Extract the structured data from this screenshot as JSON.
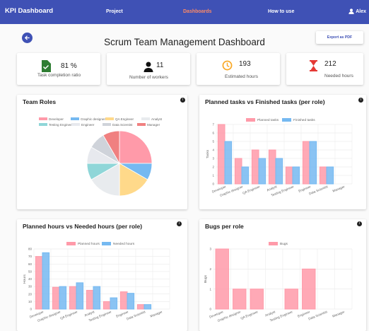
{
  "nav": {
    "brand": "KPI Dashboard",
    "items": [
      "Project",
      "Dashboards",
      "How to use"
    ],
    "user": "Alex"
  },
  "page": {
    "title": "Scrum Team Management Dashboard",
    "export_label": "Export as PDF"
  },
  "kpis": [
    {
      "value": "81 %",
      "label": "Task completion ratio",
      "icon": "check-document-icon",
      "color": "#2e7d32"
    },
    {
      "value": "11",
      "label": "Number of workers",
      "icon": "person-icon",
      "color": "#111111"
    },
    {
      "value": "193",
      "label": "Estimated hours",
      "icon": "clock-icon",
      "color": "#f9a825"
    },
    {
      "value": "212",
      "label": "Needed hours",
      "icon": "hourglass-icon",
      "color": "#e53935"
    }
  ],
  "colors": {
    "roles": [
      "#ff9aa9",
      "#75b9f1",
      "#ffd98a",
      "#e8ebee",
      "#8fd6d8",
      "#e7e9ee",
      "#cfd3da",
      "#f08080"
    ],
    "pink": "#ff9aa9",
    "blue": "#75b9f1",
    "accent": "#3f51b5"
  },
  "chart_data": [
    {
      "type": "pie",
      "title": "Team Roles",
      "legend": [
        "Developer",
        "Graphic designer",
        "QA Engineer",
        "Analyst",
        "Testing Engineer",
        "Engineer",
        "Data Scientist",
        "Manager"
      ],
      "values": [
        3,
        1,
        2,
        2,
        1,
        1,
        1,
        1
      ],
      "legend_position": "top"
    },
    {
      "type": "bar",
      "title": "Planned tasks vs Finished tasks (per role)",
      "categories": [
        "Developer",
        "Graphic designer",
        "QA Engineer",
        "Analyst",
        "Testing Engineer",
        "Engineer",
        "Data Scientist",
        "Manager"
      ],
      "series": [
        {
          "name": "Planned tasks",
          "values": [
            7,
            3,
            4,
            4,
            2,
            5,
            2,
            0
          ]
        },
        {
          "name": "Finished tasks",
          "values": [
            5,
            2,
            3,
            3,
            2,
            5,
            2,
            0
          ]
        }
      ],
      "ylabel": "Tasks",
      "ylim": [
        0,
        7
      ],
      "yticks": [
        0,
        1,
        2,
        3,
        4,
        5,
        6,
        7
      ]
    },
    {
      "type": "bar",
      "title": "Planned hours vs Needed hours (per role)",
      "categories": [
        "Developer",
        "Graphic designer",
        "QA Engineer",
        "Analyst",
        "Testing Engineer",
        "Engineer",
        "Data Scientist",
        "Manager"
      ],
      "series": [
        {
          "name": "Planned hours",
          "values": [
            70,
            29,
            30,
            25,
            10,
            23,
            6,
            0
          ]
        },
        {
          "name": "Needed hours",
          "values": [
            75,
            30,
            35,
            30,
            15,
            21,
            6,
            0
          ]
        }
      ],
      "ylabel": "Hours",
      "ylim": [
        0,
        80
      ],
      "yticks": [
        0,
        10,
        20,
        30,
        40,
        50,
        60,
        70,
        80
      ]
    },
    {
      "type": "bar",
      "title": "Bugs per role",
      "categories": [
        "Developer",
        "Graphic designer",
        "QA Engineer",
        "Analyst",
        "Testing Engineer",
        "Engineer",
        "Data Scientist",
        "Manager"
      ],
      "series": [
        {
          "name": "Bugs",
          "values": [
            3,
            1,
            1,
            0,
            1,
            2,
            0,
            0
          ]
        }
      ],
      "ylabel": "Bugs",
      "ylim": [
        0,
        3
      ],
      "yticks": [
        0,
        1,
        2,
        3
      ]
    }
  ]
}
